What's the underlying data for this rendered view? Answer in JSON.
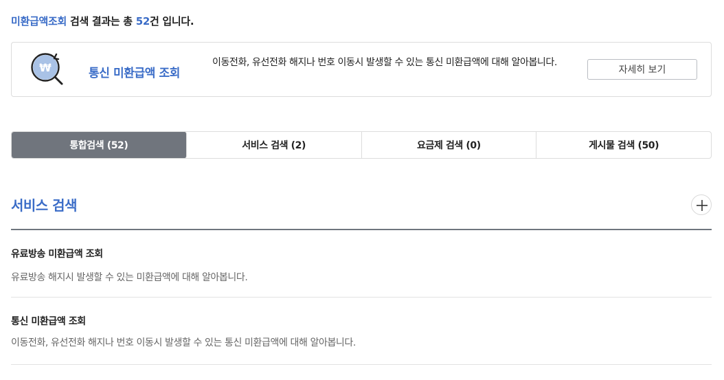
{
  "summary": {
    "prefix": "미환급액조회",
    "middle": " 검색 결과는 총 ",
    "count": "52",
    "suffix": "건 입니다."
  },
  "card": {
    "icon": "won-magnifier-icon",
    "title": "통신 미환급액 조회",
    "description": "이동전화, 유선전화 해지나 번호 이동시 발생할 수 있는 통신 미환급액에 대해 알아봅니다.",
    "button_label": "자세히 보기"
  },
  "tabs": [
    {
      "label": "통합검색 (52)",
      "active": true
    },
    {
      "label": "서비스 검색 (2)",
      "active": false
    },
    {
      "label": "요금제 검색 (0)",
      "active": false
    },
    {
      "label": "게시물 검색 (50)",
      "active": false
    }
  ],
  "section": {
    "title": "서비스 검색",
    "expand_icon": "plus-icon"
  },
  "results": [
    {
      "title": "유료방송 미환급액 조회",
      "description": "유료방송 해지시 발생할 수 있는 미환급액에 대해 알아봅니다."
    },
    {
      "title": "통신 미환급액 조회",
      "description": "이동전화, 유선전화 해지나 번호 이동시 발생할 수 있는 통신 미환급액에 대해 알아봅니다."
    }
  ],
  "colors": {
    "accent": "#3a6cc7",
    "active_tab": "#70757d",
    "rule": "#6f757e"
  }
}
